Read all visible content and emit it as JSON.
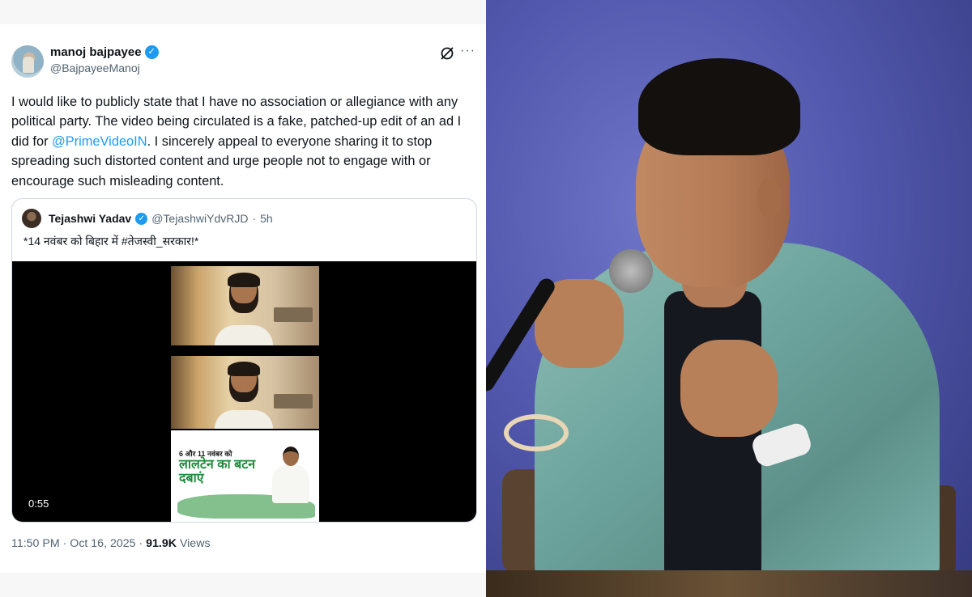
{
  "tweet": {
    "author_name": "manoj bajpayee",
    "author_handle": "@BajpayeeManoj",
    "verified_mark": "✓",
    "text_before": "I would like to publicly state that I have no association or allegiance with any political party. The video being circulated is a fake, patched-up edit of an ad I did for ",
    "mention": "@PrimeVideoIN",
    "text_after": ". I sincerely appeal to everyone sharing it to stop spreading such distorted content and urge people not to engage with or encourage such misleading content.",
    "timestamp": "11:50 PM · Oct 16, 2025 · ",
    "views_count": "91.9K",
    "views_label": "Views",
    "icons": {
      "grok": "grok-icon",
      "more": "more-icon"
    }
  },
  "quote": {
    "author_name": "Tejashwi Yadav",
    "author_handle": "@TejashwiYdvRJD",
    "separator": "·",
    "time": "5h",
    "text": "*14 नवंबर को बिहार में #तेजस्वी_सरकार!*",
    "video": {
      "duration": "0:55",
      "ad_line1": "6 और 11 नवंबर को",
      "ad_line2": "लालटेन का बटन दबाएं"
    }
  },
  "colors": {
    "link": "#1d9bf0",
    "secondary_text": "#536471",
    "primary_text": "#0f1419",
    "photo_background": "#5258ad"
  }
}
